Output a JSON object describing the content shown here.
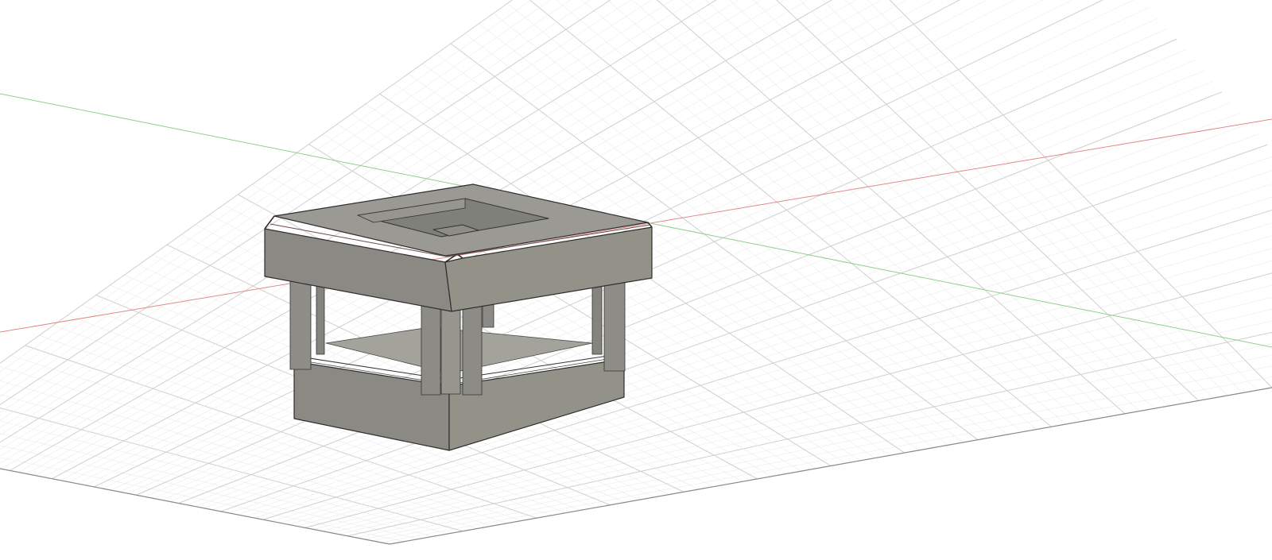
{
  "viewport": {
    "background": "#ffffff",
    "grid_minor_color": "#ececec",
    "grid_major_color": "#cfcfcf",
    "grid_edge_color": "#8a8a8a",
    "x_axis_color": "#e08a8a",
    "y_axis_color": "#8fd08f"
  },
  "model": {
    "top_color": "#9a9993",
    "front_left_color": "#8a8983",
    "front_right_color": "#939289",
    "edge_color": "#2e2e2e"
  }
}
